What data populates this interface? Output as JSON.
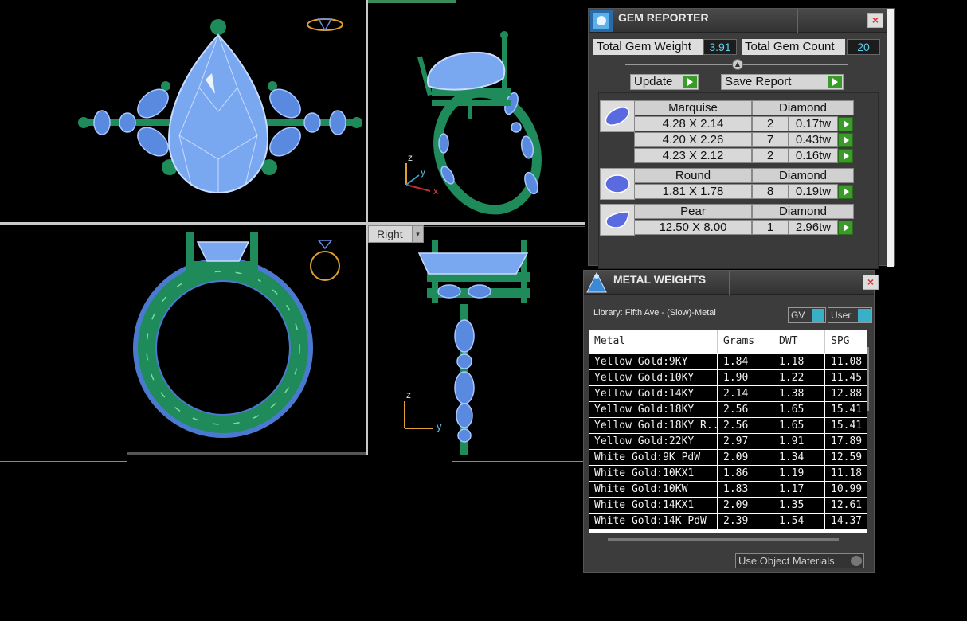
{
  "viewports": {
    "right_label": "Right",
    "axis_labels": {
      "z": "z",
      "y": "y",
      "x": "x"
    }
  },
  "gem_reporter": {
    "title": "GEM REPORTER",
    "close": "×",
    "total_weight_label": "Total Gem Weight",
    "total_weight_value": "3.91",
    "total_count_label": "Total Gem Count",
    "total_count_value": "20",
    "update_label": "Update",
    "save_label": "Save Report",
    "groups": [
      {
        "shape": "Marquise",
        "material": "Diamond",
        "rows": [
          {
            "size": "4.28 X 2.14",
            "count": "2",
            "weight": "0.17tw"
          },
          {
            "size": "4.20 X 2.26",
            "count": "7",
            "weight": "0.43tw"
          },
          {
            "size": "4.23 X 2.12",
            "count": "2",
            "weight": "0.16tw"
          }
        ]
      },
      {
        "shape": "Round",
        "material": "Diamond",
        "rows": [
          {
            "size": "1.81 X 1.78",
            "count": "8",
            "weight": "0.19tw"
          }
        ]
      },
      {
        "shape": "Pear",
        "material": "Diamond",
        "rows": [
          {
            "size": "12.50 X 8.00",
            "count": "1",
            "weight": "2.96tw"
          }
        ]
      }
    ]
  },
  "metal_weights": {
    "title": "METAL WEIGHTS",
    "close": "×",
    "library": "Library: Fifth Ave - (Slow)-Metal",
    "gv_label": "GV",
    "user_label": "User",
    "columns": [
      "Metal",
      "Grams",
      "DWT",
      "SPG"
    ],
    "rows": [
      [
        "Yellow Gold:9KY",
        "1.84",
        "1.18",
        "11.08"
      ],
      [
        "Yellow Gold:10KY",
        "1.90",
        "1.22",
        "11.45"
      ],
      [
        "Yellow Gold:14KY",
        "2.14",
        "1.38",
        "12.88"
      ],
      [
        "Yellow Gold:18KY",
        "2.56",
        "1.65",
        "15.41"
      ],
      [
        "Yellow Gold:18KY R...",
        "2.56",
        "1.65",
        "15.41"
      ],
      [
        "Yellow Gold:22KY",
        "2.97",
        "1.91",
        "17.89"
      ],
      [
        "White Gold:9K PdW",
        "2.09",
        "1.34",
        "12.59"
      ],
      [
        "White Gold:10KX1",
        "1.86",
        "1.19",
        "11.18"
      ],
      [
        "White Gold:10KW",
        "1.83",
        "1.17",
        "10.99"
      ],
      [
        "White Gold:14KX1",
        "2.09",
        "1.35",
        "12.61"
      ],
      [
        "White Gold:14K PdW",
        "2.39",
        "1.54",
        "14.37"
      ]
    ],
    "footer_option": "Use Object Materials"
  },
  "colors": {
    "metal_green": "#1f8a5a",
    "gem_blue": "#8ab4f0",
    "go_green": "#3a9a2a",
    "value_cyan": "#5ed0f0"
  }
}
